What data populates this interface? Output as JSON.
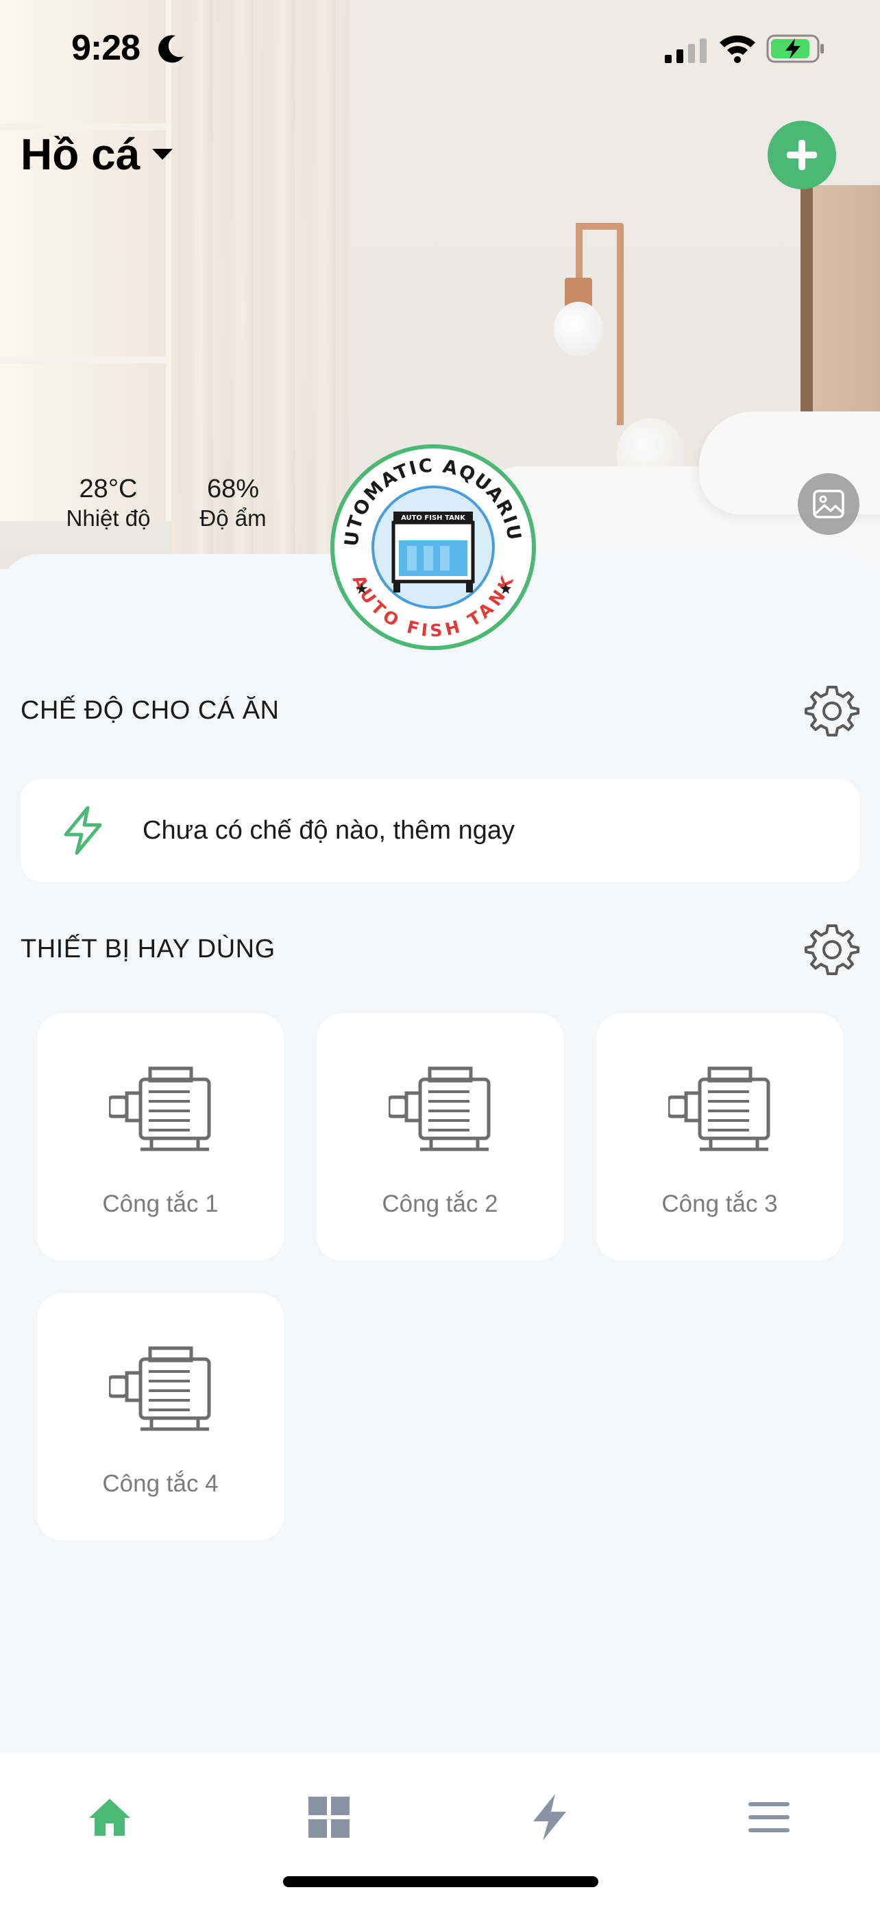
{
  "status_bar": {
    "time": "9:28"
  },
  "header": {
    "home_name": "Hồ cá"
  },
  "weather": {
    "temperature": "28°C",
    "temperature_label": "Nhiệt độ",
    "humidity": "68%",
    "humidity_label": "Độ ẩm"
  },
  "logo": {
    "top_text": "AUTOMATIC AQUARIUM",
    "bottom_text": "AUTO FISH TANK",
    "inner_text": "AUTO FISH TANK"
  },
  "scenes": {
    "title": "CHẾ ĐỘ CHO CÁ ĂN",
    "empty_text": "Chưa có chế độ nào, thêm ngay"
  },
  "devices": {
    "title": "THIẾT BỊ HAY DÙNG",
    "items": [
      {
        "label": "Công tắc 1"
      },
      {
        "label": "Công tắc 2"
      },
      {
        "label": "Công tắc 3"
      },
      {
        "label": "Công tắc 4"
      }
    ]
  },
  "tab_bar": {
    "tabs": [
      {
        "icon": "home-icon",
        "active": true
      },
      {
        "icon": "grid-icon",
        "active": false
      },
      {
        "icon": "bolt-icon",
        "active": false
      },
      {
        "icon": "menu-icon",
        "active": false
      }
    ]
  },
  "colors": {
    "accent": "#4cb876",
    "inactive_icon": "#8a93a3",
    "device_text": "#7b7b7b",
    "background": "#f5f6f7"
  }
}
